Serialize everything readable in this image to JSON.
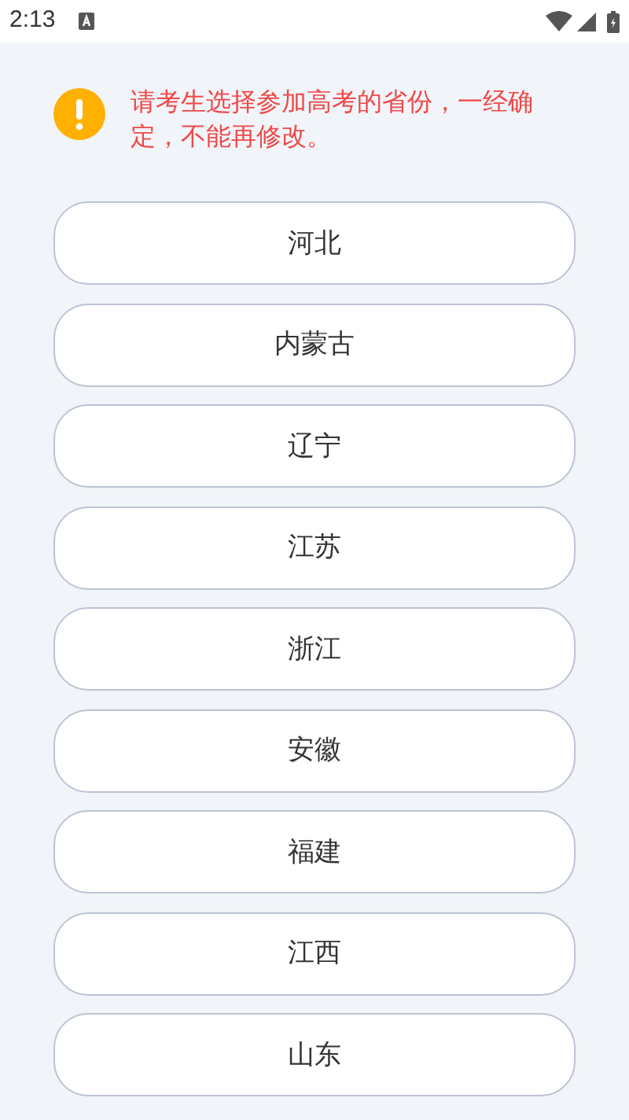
{
  "status_bar": {
    "time": "2:13"
  },
  "notice": {
    "text": "请考生选择参加高考的省份，一经确定，不能再修改。"
  },
  "provinces": [
    {
      "label": "河北"
    },
    {
      "label": "内蒙古"
    },
    {
      "label": "辽宁"
    },
    {
      "label": "江苏"
    },
    {
      "label": "浙江"
    },
    {
      "label": "安徽"
    },
    {
      "label": "福建"
    },
    {
      "label": "江西"
    },
    {
      "label": "山东"
    }
  ]
}
